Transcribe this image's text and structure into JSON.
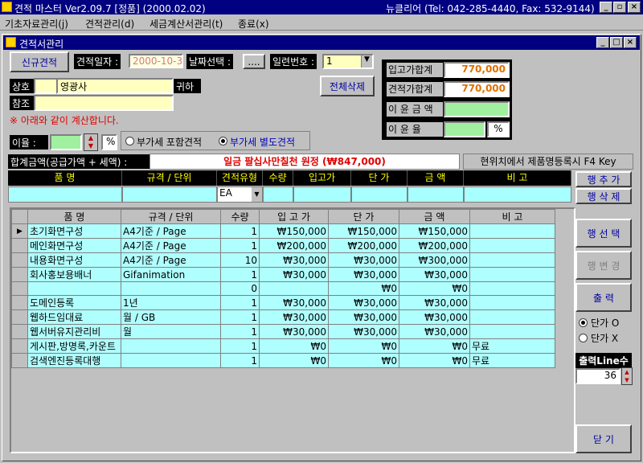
{
  "app": {
    "title": "견적 마스터 Ver2.09.7 [정품] (2000.02.02)",
    "info": "뉴클리어 (Tel: 042-285-4440, Fax: 532-9144)"
  },
  "menu": [
    "기초자료관리(j)",
    "견적관리(d)",
    "세금계산서관리(t)",
    "종료(x)"
  ],
  "child": {
    "title": "견적서관리"
  },
  "form": {
    "new_quote": "신규견적",
    "date_label": "견적일자 :",
    "date_value": "2000-10-30",
    "date_select_label": "날짜선택 :",
    "date_btn": "....",
    "serial_label": "일련번호 :",
    "serial_value": "1",
    "delete_all": "전체삭제",
    "company_label": "상호",
    "company_value": "영광사",
    "company_suffix": "귀하",
    "ref_label": "참조",
    "ref_value": "",
    "note": "※ 아래와 같이 계산합니다.",
    "rate_label": "이율 :",
    "rate_value": "",
    "percent": "%",
    "vat_incl": "부가세 포함견적",
    "vat_excl": "부가세 별도견적",
    "vat_selected": "excl",
    "total_label": "합계금액(공급가액 + 세액) :",
    "total_value": "일금 팔십사만칠천 원정 (₩847,000)",
    "f4_hint": "현위치에서 제품명등록시 F4 Key"
  },
  "summary": {
    "cost_label": "입고가합계",
    "cost_value": "770,000",
    "quote_label": "견적가합계",
    "quote_value": "770,000",
    "profit_label": "이 윤 금 액",
    "profit_value": "",
    "margin_label": "이 윤 율",
    "margin_value": "",
    "margin_unit": "%"
  },
  "entry": {
    "headers": [
      "품 명",
      "규격 / 단위",
      "견적유형",
      "수량",
      "입고가",
      "단 가",
      "금 액",
      "비 고"
    ],
    "type_value": "EA",
    "add_row": "행 추 가",
    "del_row": "행 삭 제"
  },
  "table": {
    "headers": [
      "품 명",
      "규격 / 단위",
      "수량",
      "입 고 가",
      "단 가",
      "금 액",
      "비 고"
    ],
    "rows": [
      [
        "초기화면구성",
        "A4기준 / Page",
        "1",
        "₩150,000",
        "₩150,000",
        "₩150,000",
        ""
      ],
      [
        "메인화면구성",
        "A4기준 / Page",
        "1",
        "₩200,000",
        "₩200,000",
        "₩200,000",
        ""
      ],
      [
        "내용화면구성",
        "A4기준 / Page",
        "10",
        "₩30,000",
        "₩30,000",
        "₩300,000",
        ""
      ],
      [
        "회사홍보용배너",
        "Gifanimation",
        "1",
        "₩30,000",
        "₩30,000",
        "₩30,000",
        ""
      ],
      [
        "",
        "",
        "0",
        "",
        "₩0",
        "₩0",
        ""
      ],
      [
        "도메인등록",
        "1년",
        "1",
        "₩30,000",
        "₩30,000",
        "₩30,000",
        ""
      ],
      [
        "웹하드임대료",
        "월 / GB",
        "1",
        "₩30,000",
        "₩30,000",
        "₩30,000",
        ""
      ],
      [
        "웹서버유지관리비",
        "월",
        "1",
        "₩30,000",
        "₩30,000",
        "₩30,000",
        ""
      ],
      [
        "게시판,방명록,카운트",
        "",
        "1",
        "₩0",
        "₩0",
        "₩0",
        "무료"
      ],
      [
        "검색엔진등록대행",
        "",
        "1",
        "₩0",
        "₩0",
        "₩0",
        "무료"
      ]
    ]
  },
  "side": {
    "select_row": "행 선 택",
    "change_row": "행 변 경",
    "print": "출 력",
    "unit_o": "단가 O",
    "unit_x": "단가 X",
    "line_label": "출력Line수",
    "line_value": "36",
    "close": "닫 기"
  }
}
